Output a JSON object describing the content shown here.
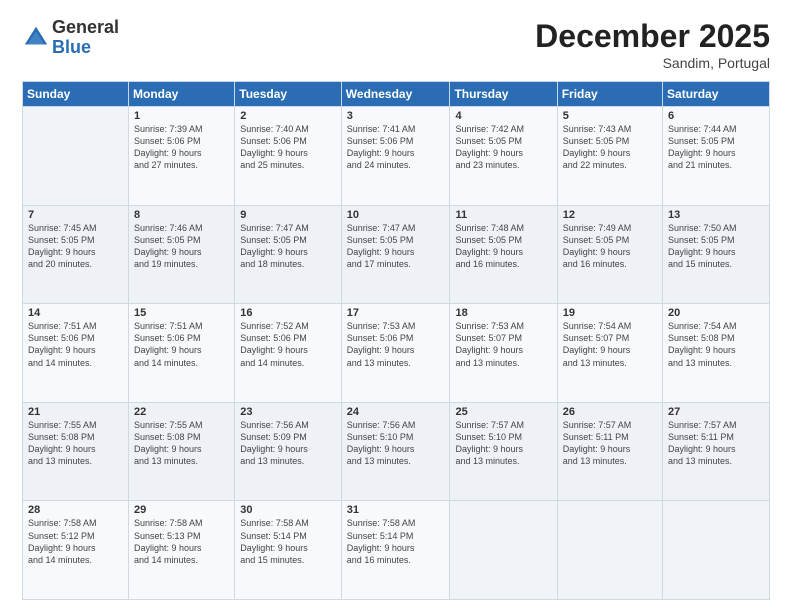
{
  "logo": {
    "general": "General",
    "blue": "Blue"
  },
  "title": "December 2025",
  "location": "Sandim, Portugal",
  "days_header": [
    "Sunday",
    "Monday",
    "Tuesday",
    "Wednesday",
    "Thursday",
    "Friday",
    "Saturday"
  ],
  "weeks": [
    [
      {
        "day": "",
        "info": ""
      },
      {
        "day": "1",
        "info": "Sunrise: 7:39 AM\nSunset: 5:06 PM\nDaylight: 9 hours\nand 27 minutes."
      },
      {
        "day": "2",
        "info": "Sunrise: 7:40 AM\nSunset: 5:06 PM\nDaylight: 9 hours\nand 25 minutes."
      },
      {
        "day": "3",
        "info": "Sunrise: 7:41 AM\nSunset: 5:06 PM\nDaylight: 9 hours\nand 24 minutes."
      },
      {
        "day": "4",
        "info": "Sunrise: 7:42 AM\nSunset: 5:05 PM\nDaylight: 9 hours\nand 23 minutes."
      },
      {
        "day": "5",
        "info": "Sunrise: 7:43 AM\nSunset: 5:05 PM\nDaylight: 9 hours\nand 22 minutes."
      },
      {
        "day": "6",
        "info": "Sunrise: 7:44 AM\nSunset: 5:05 PM\nDaylight: 9 hours\nand 21 minutes."
      }
    ],
    [
      {
        "day": "7",
        "info": "Sunrise: 7:45 AM\nSunset: 5:05 PM\nDaylight: 9 hours\nand 20 minutes."
      },
      {
        "day": "8",
        "info": "Sunrise: 7:46 AM\nSunset: 5:05 PM\nDaylight: 9 hours\nand 19 minutes."
      },
      {
        "day": "9",
        "info": "Sunrise: 7:47 AM\nSunset: 5:05 PM\nDaylight: 9 hours\nand 18 minutes."
      },
      {
        "day": "10",
        "info": "Sunrise: 7:47 AM\nSunset: 5:05 PM\nDaylight: 9 hours\nand 17 minutes."
      },
      {
        "day": "11",
        "info": "Sunrise: 7:48 AM\nSunset: 5:05 PM\nDaylight: 9 hours\nand 16 minutes."
      },
      {
        "day": "12",
        "info": "Sunrise: 7:49 AM\nSunset: 5:05 PM\nDaylight: 9 hours\nand 16 minutes."
      },
      {
        "day": "13",
        "info": "Sunrise: 7:50 AM\nSunset: 5:05 PM\nDaylight: 9 hours\nand 15 minutes."
      }
    ],
    [
      {
        "day": "14",
        "info": "Sunrise: 7:51 AM\nSunset: 5:06 PM\nDaylight: 9 hours\nand 14 minutes."
      },
      {
        "day": "15",
        "info": "Sunrise: 7:51 AM\nSunset: 5:06 PM\nDaylight: 9 hours\nand 14 minutes."
      },
      {
        "day": "16",
        "info": "Sunrise: 7:52 AM\nSunset: 5:06 PM\nDaylight: 9 hours\nand 14 minutes."
      },
      {
        "day": "17",
        "info": "Sunrise: 7:53 AM\nSunset: 5:06 PM\nDaylight: 9 hours\nand 13 minutes."
      },
      {
        "day": "18",
        "info": "Sunrise: 7:53 AM\nSunset: 5:07 PM\nDaylight: 9 hours\nand 13 minutes."
      },
      {
        "day": "19",
        "info": "Sunrise: 7:54 AM\nSunset: 5:07 PM\nDaylight: 9 hours\nand 13 minutes."
      },
      {
        "day": "20",
        "info": "Sunrise: 7:54 AM\nSunset: 5:08 PM\nDaylight: 9 hours\nand 13 minutes."
      }
    ],
    [
      {
        "day": "21",
        "info": "Sunrise: 7:55 AM\nSunset: 5:08 PM\nDaylight: 9 hours\nand 13 minutes."
      },
      {
        "day": "22",
        "info": "Sunrise: 7:55 AM\nSunset: 5:08 PM\nDaylight: 9 hours\nand 13 minutes."
      },
      {
        "day": "23",
        "info": "Sunrise: 7:56 AM\nSunset: 5:09 PM\nDaylight: 9 hours\nand 13 minutes."
      },
      {
        "day": "24",
        "info": "Sunrise: 7:56 AM\nSunset: 5:10 PM\nDaylight: 9 hours\nand 13 minutes."
      },
      {
        "day": "25",
        "info": "Sunrise: 7:57 AM\nSunset: 5:10 PM\nDaylight: 9 hours\nand 13 minutes."
      },
      {
        "day": "26",
        "info": "Sunrise: 7:57 AM\nSunset: 5:11 PM\nDaylight: 9 hours\nand 13 minutes."
      },
      {
        "day": "27",
        "info": "Sunrise: 7:57 AM\nSunset: 5:11 PM\nDaylight: 9 hours\nand 13 minutes."
      }
    ],
    [
      {
        "day": "28",
        "info": "Sunrise: 7:58 AM\nSunset: 5:12 PM\nDaylight: 9 hours\nand 14 minutes."
      },
      {
        "day": "29",
        "info": "Sunrise: 7:58 AM\nSunset: 5:13 PM\nDaylight: 9 hours\nand 14 minutes."
      },
      {
        "day": "30",
        "info": "Sunrise: 7:58 AM\nSunset: 5:14 PM\nDaylight: 9 hours\nand 15 minutes."
      },
      {
        "day": "31",
        "info": "Sunrise: 7:58 AM\nSunset: 5:14 PM\nDaylight: 9 hours\nand 16 minutes."
      },
      {
        "day": "",
        "info": ""
      },
      {
        "day": "",
        "info": ""
      },
      {
        "day": "",
        "info": ""
      }
    ]
  ]
}
